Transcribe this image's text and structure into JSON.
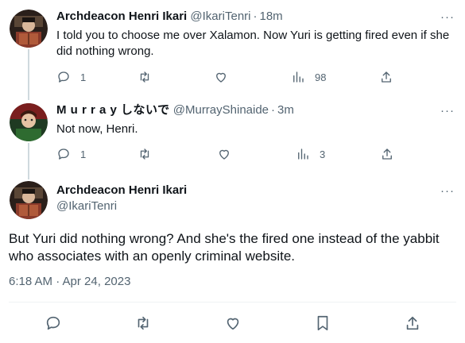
{
  "tweets": [
    {
      "name": "Archdeacon Henri Ikari",
      "handle": "@IkariTenri",
      "separator": "·",
      "time": "18m",
      "text": "I told you to choose me over Xalamon. Now Yuri is getting fired even if she did nothing wrong.",
      "replies": "1",
      "retweets": "",
      "likes": "",
      "views": "98"
    },
    {
      "name": "M u r r a y しないで",
      "handle": "@MurrayShinaide",
      "separator": "·",
      "time": "3m",
      "text": "Not now, Henri.",
      "replies": "1",
      "retweets": "",
      "likes": "",
      "views": "3"
    }
  ],
  "main_tweet": {
    "name": "Archdeacon Henri Ikari",
    "handle": "@IkariTenri",
    "text": "But Yuri did nothing wrong? And she's the fired one instead of the yabbit who associates with an openly criminal website.",
    "timestamp": "6:18 AM · Apr 24, 2023"
  },
  "more_label": "···",
  "colors": {
    "text": "#0f1419",
    "secondary": "#536471",
    "thread_line": "#cfd9de",
    "divider": "#eff3f4"
  },
  "icons": [
    "reply-icon",
    "retweet-icon",
    "like-icon",
    "views-icon",
    "share-icon",
    "bookmark-icon",
    "more-icon"
  ]
}
